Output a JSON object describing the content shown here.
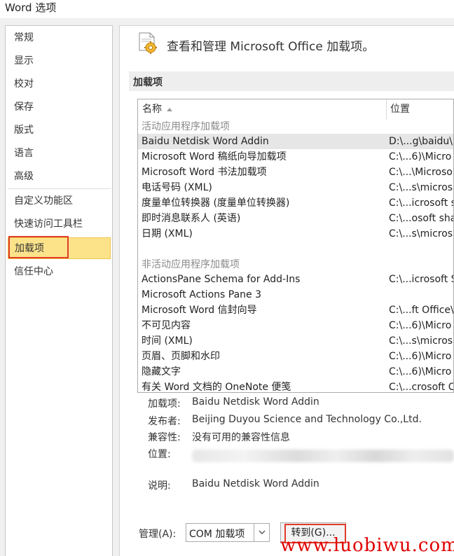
{
  "window": {
    "title": "Word 选项"
  },
  "sidebar": {
    "items": [
      {
        "label": "常规"
      },
      {
        "label": "显示"
      },
      {
        "label": "校对"
      },
      {
        "label": "保存"
      },
      {
        "label": "版式"
      },
      {
        "label": "语言"
      },
      {
        "label": "高级"
      },
      {
        "label": "自定义功能区"
      },
      {
        "label": "快速访问工具栏"
      },
      {
        "label": "加载项",
        "selected": true
      },
      {
        "label": "信任中心"
      }
    ]
  },
  "main": {
    "header": "查看和管理 Microsoft Office 加载项。",
    "section_title": "加载项",
    "table": {
      "columns": {
        "name": "名称",
        "location": "位置"
      },
      "active_group": "活动应用程序加载项",
      "active_rows": [
        {
          "name": "Baidu Netdisk Word Addin",
          "location": "D:\\...g\\baidu\\",
          "selected": true
        },
        {
          "name": "Microsoft Word 稿纸向导加载项",
          "location": "C:\\...6)\\Micro"
        },
        {
          "name": "Microsoft Word 书法加载项",
          "location": "C:\\...\\Microso"
        },
        {
          "name": "电话号码 (XML)",
          "location": "C:\\...s\\micros"
        },
        {
          "name": "度量单位转换器 (度量单位转换器)",
          "location": "C:\\...icrosoft s"
        },
        {
          "name": "即时消息联系人 (英语)",
          "location": "C:\\...osoft sha"
        },
        {
          "name": "日期 (XML)",
          "location": "C:\\...s\\micros"
        }
      ],
      "inactive_group": "非活动应用程序加载项",
      "inactive_rows": [
        {
          "name": "ActionsPane Schema for Add-Ins",
          "location": "C:\\...icrosoft S"
        },
        {
          "name": "Microsoft Actions Pane 3",
          "location": ""
        },
        {
          "name": "Microsoft Word 信封向导",
          "location": "C:\\...ft Office\\"
        },
        {
          "name": "不可见内容",
          "location": "C:\\...6)\\Micro"
        },
        {
          "name": "时间 (XML)",
          "location": "C:\\...s\\micros"
        },
        {
          "name": "页眉、页脚和水印",
          "location": "C:\\...6)\\Micro"
        },
        {
          "name": "隐藏文字",
          "location": "C:\\...6)\\Micro"
        },
        {
          "name": "有关 Word 文档的 OneNote 便笺",
          "location": "C:\\...crosoft C"
        }
      ]
    },
    "details": {
      "addin_label": "加载项:",
      "addin_value": "Baidu Netdisk Word Addin",
      "publisher_label": "发布者:",
      "publisher_value": "Beijing Duyou Science and Technology Co.,Ltd.",
      "compat_label": "兼容性:",
      "compat_value": "没有可用的兼容性信息",
      "location_label": "位置:",
      "desc_label": "说明:",
      "desc_value": "Baidu Netdisk Word Addin"
    },
    "manage": {
      "label": "管理(A):",
      "select_value": "COM 加载项",
      "goto_label": "转到(G)..."
    }
  },
  "watermark": "www.luobiwu.com",
  "colors": {
    "selected_nav_bg": "#fce38a",
    "highlight_box": "#e03c2a",
    "watermark": "#e00000"
  }
}
